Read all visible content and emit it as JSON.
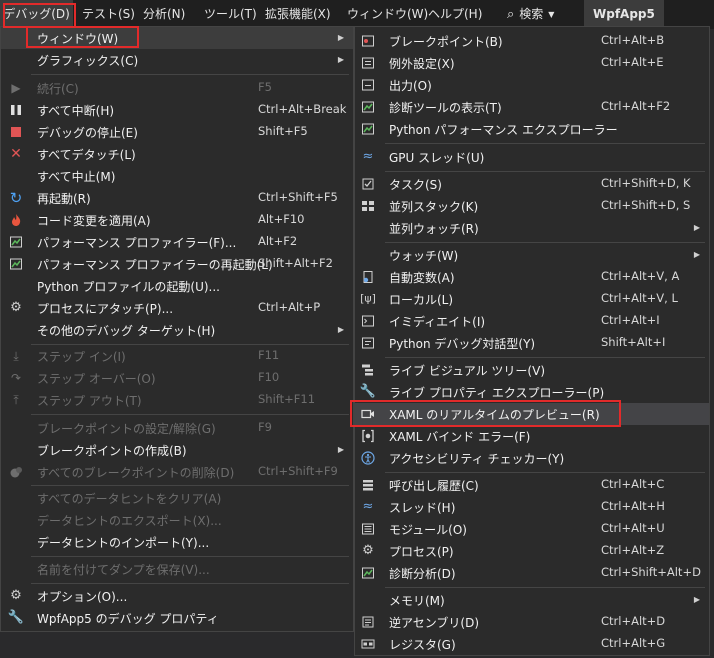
{
  "menubar": {
    "debug": "デバッグ(D)",
    "test": "テスト(S)",
    "analyze": "分析(N)",
    "tools": "ツール(T)",
    "extensions": "拡張機能(X)",
    "window": "ウィンドウ(W)",
    "help": "ヘルプ(H)",
    "search": "検索",
    "app": "WpfApp5"
  },
  "colors": {
    "highlight_box": "#e22a2a",
    "menu_bg": "#2b2b2b",
    "selected_bg": "#3d3d3d",
    "accent": "#b180d7"
  },
  "debug_menu": {
    "windows": "ウィンドウ(W)",
    "graphics": "グラフィックス(C)",
    "continue": "続行(C)",
    "continue_sc": "F5",
    "break_all": "すべて中断(H)",
    "break_all_sc": "Ctrl+Alt+Break",
    "stop": "デバッグの停止(E)",
    "stop_sc": "Shift+F5",
    "detach_all": "すべてデタッチ(L)",
    "terminate_all": "すべて中止(M)",
    "restart": "再起動(R)",
    "restart_sc": "Ctrl+Shift+F5",
    "apply_changes": "コード変更を適用(A)",
    "apply_changes_sc": "Alt+F10",
    "profiler": "パフォーマンス プロファイラー(F)...",
    "profiler_sc": "Alt+F2",
    "profiler_restart": "パフォーマンス プロファイラーの再起動(L)",
    "profiler_restart_sc": "Shift+Alt+F2",
    "python_profile": "Python プロファイルの起動(U)...",
    "attach": "プロセスにアタッチ(P)...",
    "attach_sc": "Ctrl+Alt+P",
    "other_targets": "その他のデバッグ ターゲット(H)",
    "step_into": "ステップ イン(I)",
    "step_into_sc": "F11",
    "step_over": "ステップ オーバー(O)",
    "step_over_sc": "F10",
    "step_out": "ステップ アウト(T)",
    "step_out_sc": "Shift+F11",
    "toggle_bp": "ブレークポイントの設定/解除(G)",
    "toggle_bp_sc": "F9",
    "new_bp": "ブレークポイントの作成(B)",
    "delete_all_bp": "すべてのブレークポイントの削除(D)",
    "delete_all_bp_sc": "Ctrl+Shift+F9",
    "clear_datatips": "すべてのデータヒントをクリア(A)",
    "export_datatips": "データヒントのエクスポート(X)...",
    "import_datatips": "データヒントのインポート(Y)...",
    "save_dump": "名前を付けてダンプを保存(V)...",
    "options": "オプション(O)...",
    "properties": "WpfApp5 のデバッグ プロパティ"
  },
  "windows_menu": {
    "breakpoints": "ブレークポイント(B)",
    "breakpoints_sc": "Ctrl+Alt+B",
    "exceptions": "例外設定(X)",
    "exceptions_sc": "Ctrl+Alt+E",
    "output": "出力(O)",
    "diag_tools": "診断ツールの表示(T)",
    "diag_tools_sc": "Ctrl+Alt+F2",
    "python_perf": "Python パフォーマンス エクスプローラー",
    "gpu_threads": "GPU スレッド(U)",
    "tasks": "タスク(S)",
    "tasks_sc": "Ctrl+Shift+D, K",
    "parallel_stacks": "並列スタック(K)",
    "parallel_stacks_sc": "Ctrl+Shift+D, S",
    "parallel_watch": "並列ウォッチ(R)",
    "watch": "ウォッチ(W)",
    "autos": "自動変数(A)",
    "autos_sc": "Ctrl+Alt+V, A",
    "locals": "ローカル(L)",
    "locals_sc": "Ctrl+Alt+V, L",
    "immediate": "イミディエイト(I)",
    "immediate_sc": "Ctrl+Alt+I",
    "python_interactive": "Python デバッグ対話型(Y)",
    "python_interactive_sc": "Shift+Alt+I",
    "live_visual_tree": "ライブ ビジュアル ツリー(V)",
    "live_property": "ライブ プロパティ エクスプローラー(P)",
    "xaml_preview": "XAML のリアルタイムのプレビュー(R)",
    "xaml_binding": "XAML バインド エラー(F)",
    "accessibility": "アクセシビリティ チェッカー(Y)",
    "call_stack": "呼び出し履歴(C)",
    "call_stack_sc": "Ctrl+Alt+C",
    "threads": "スレッド(H)",
    "threads_sc": "Ctrl+Alt+H",
    "modules": "モジュール(O)",
    "modules_sc": "Ctrl+Alt+U",
    "processes": "プロセス(P)",
    "processes_sc": "Ctrl+Alt+Z",
    "diagnostics": "診断分析(D)",
    "diagnostics_sc": "Ctrl+Shift+Alt+D",
    "memory": "メモリ(M)",
    "disassembly": "逆アセンブリ(D)",
    "disassembly_sc": "Ctrl+Alt+D",
    "registers": "レジスタ(G)",
    "registers_sc": "Ctrl+Alt+G"
  }
}
